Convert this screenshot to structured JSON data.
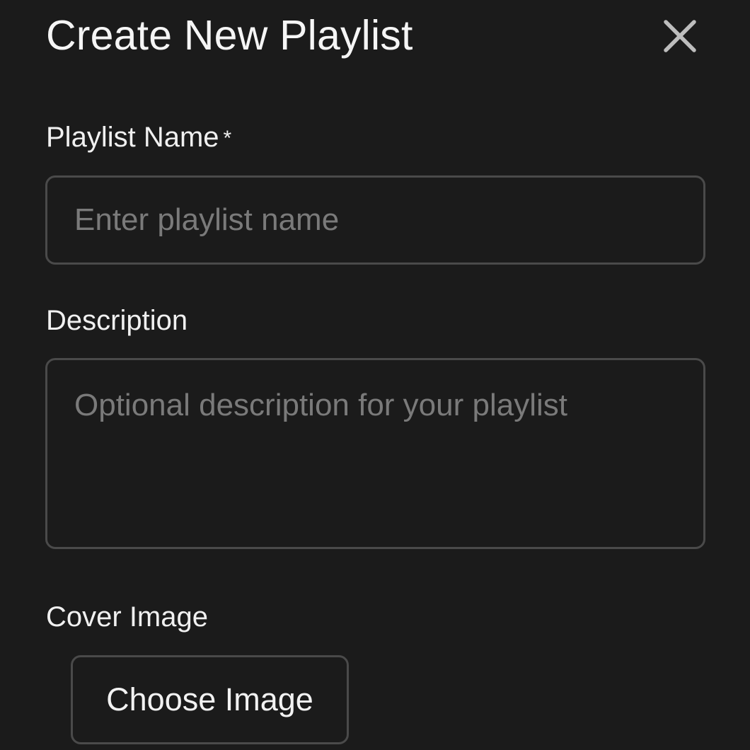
{
  "dialog": {
    "title": "Create New Playlist",
    "close_icon": "close-icon"
  },
  "fields": {
    "name": {
      "label": "Playlist Name",
      "required_mark": "*",
      "placeholder": "Enter playlist name",
      "value": ""
    },
    "description": {
      "label": "Description",
      "placeholder": "Optional description for your playlist",
      "value": ""
    },
    "cover": {
      "label": "Cover Image",
      "button_label": "Choose Image"
    }
  },
  "colors": {
    "background": "#1b1b1b",
    "border": "#4a4a4a",
    "text": "#f2f2f2",
    "placeholder": "#7a7a7a",
    "icon": "#bdbdbd"
  }
}
